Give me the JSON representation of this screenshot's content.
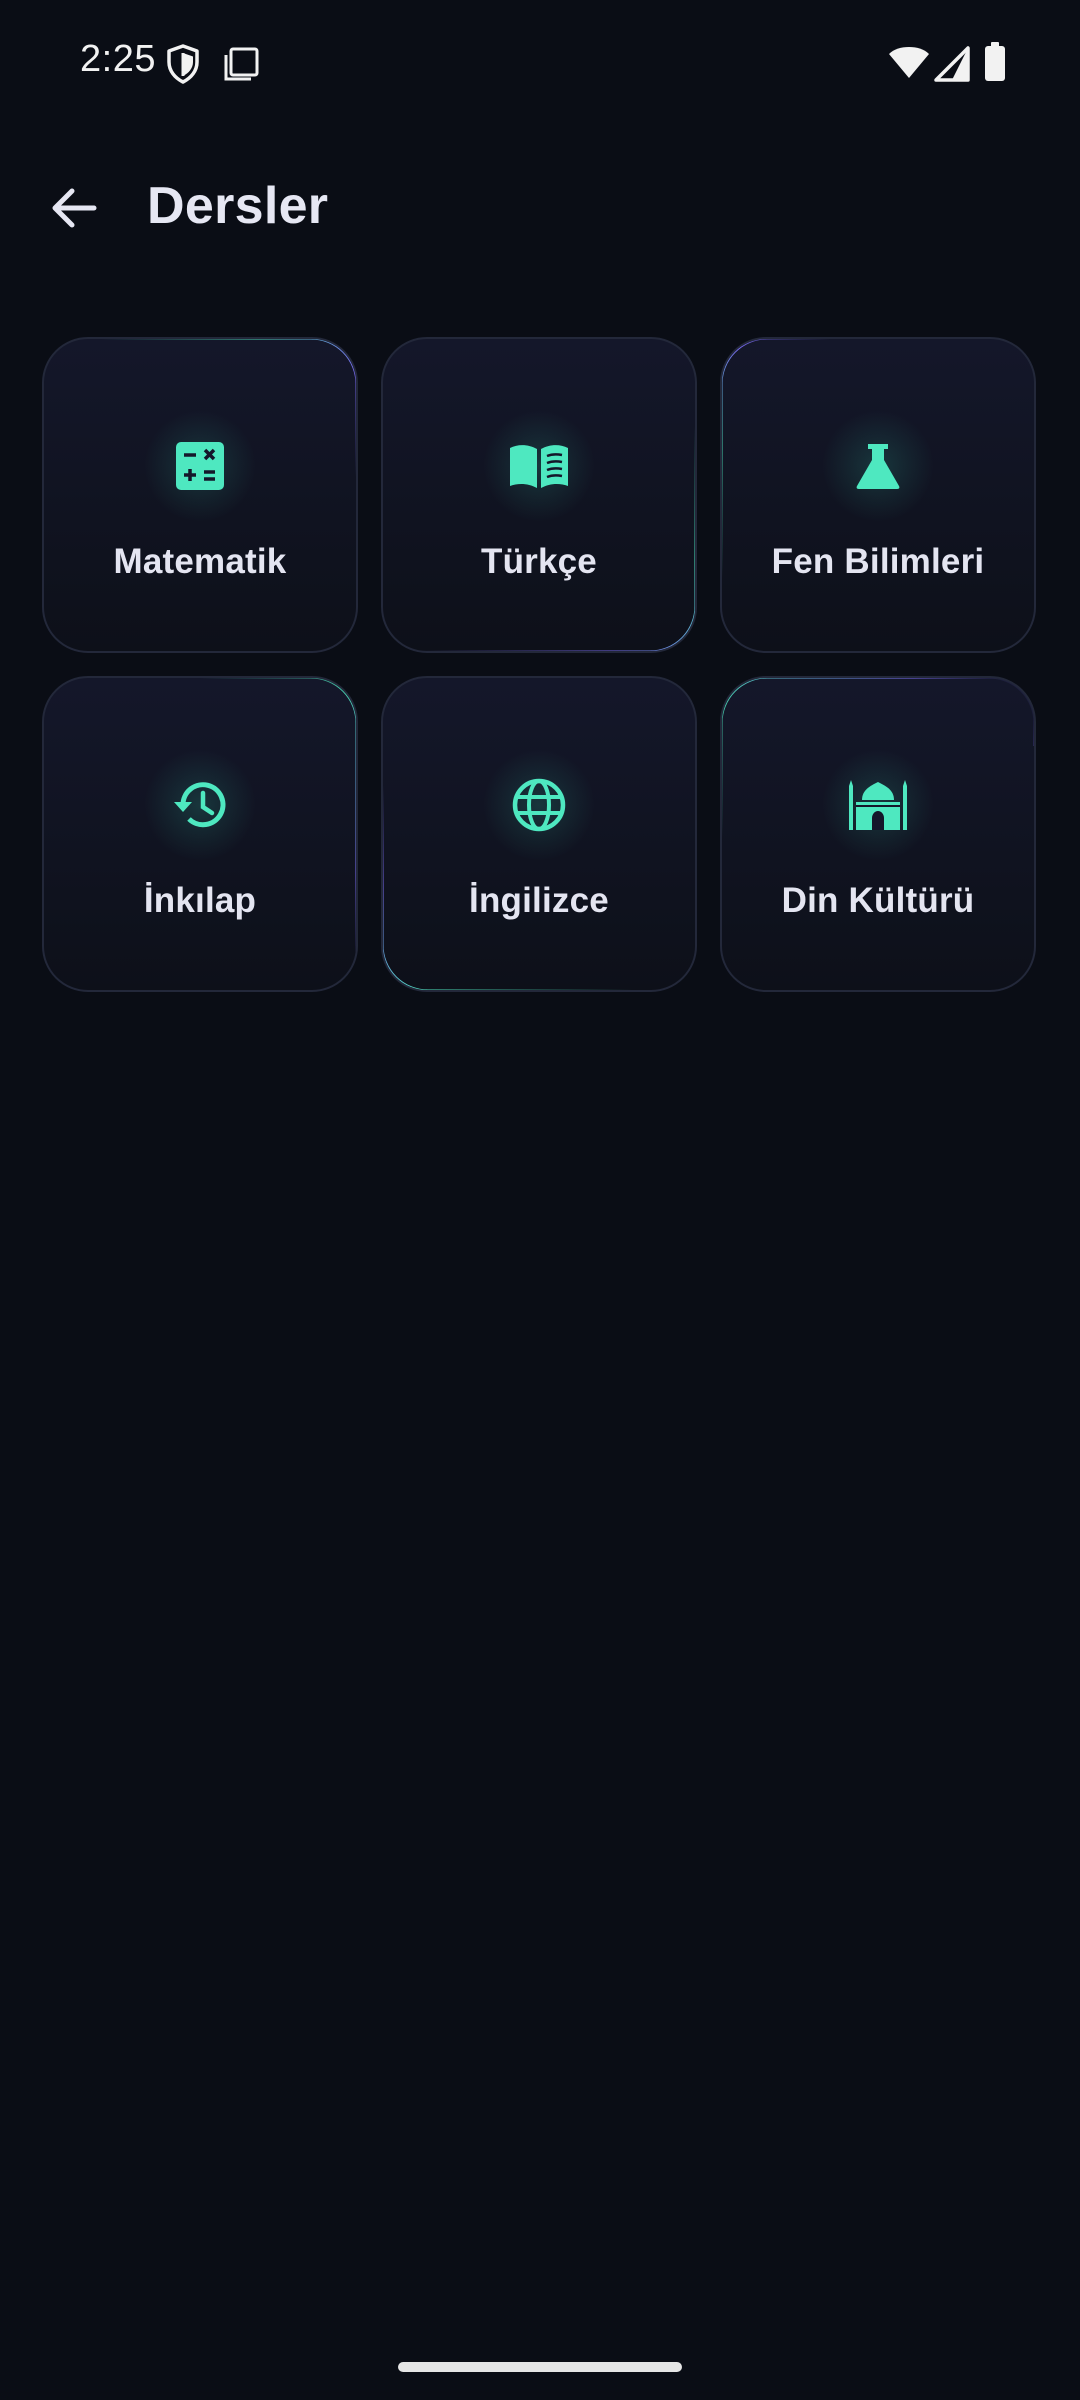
{
  "status_bar": {
    "time": "2:25",
    "icons_left": [
      "shield-icon",
      "screenshot-icon"
    ],
    "icons_right": [
      "wifi-icon",
      "cellular-signal-icon",
      "battery-icon"
    ]
  },
  "app_bar": {
    "title": "Dersler",
    "back_icon": "arrow-back-icon"
  },
  "colors": {
    "background": "#0a0d15",
    "accent_teal": "#4ee8c0",
    "accent_purple": "#7b6cf6",
    "text_primary": "#e4e5f1"
  },
  "subjects": [
    {
      "label": "Matematik",
      "icon": "calculator-icon"
    },
    {
      "label": "Türkçe",
      "icon": "book-icon"
    },
    {
      "label": "Fen Bilimleri",
      "icon": "flask-icon"
    },
    {
      "label": "İnkılap",
      "icon": "history-icon"
    },
    {
      "label": "İngilizce",
      "icon": "globe-icon"
    },
    {
      "label": "Din Kültürü",
      "icon": "mosque-icon"
    }
  ]
}
